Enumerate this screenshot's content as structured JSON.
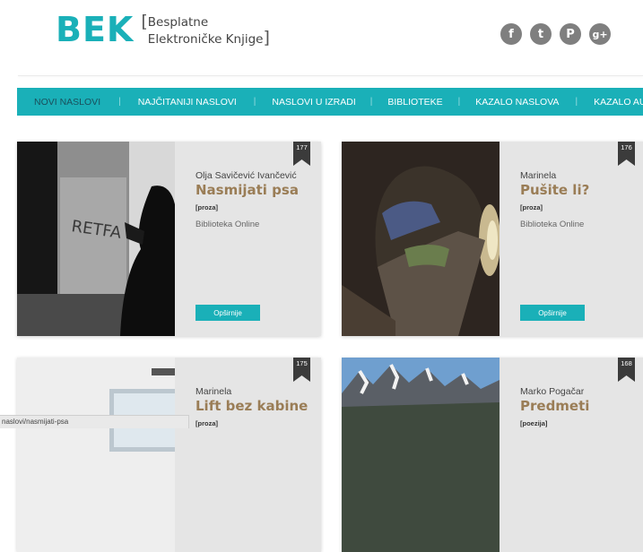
{
  "logo": {
    "brand": "BEK",
    "bracket_open": "[",
    "bracket_close": "]",
    "line1": "Besplatne",
    "line2": "Elektroničke Knjige"
  },
  "social": [
    {
      "name": "facebook-icon",
      "glyph": "f"
    },
    {
      "name": "twitter-icon",
      "glyph": "t"
    },
    {
      "name": "pinterest-icon",
      "glyph": "P"
    },
    {
      "name": "google-plus-icon",
      "glyph": "g+"
    }
  ],
  "nav": {
    "items": [
      "NOVI NASLOVI",
      "NAJČITANIJI NASLOVI",
      "NASLOVI U IZRADI",
      "BIBLIOTEKE",
      "KAZALO NASLOVA",
      "KAZALO AUTORA"
    ],
    "separator": "|"
  },
  "cards": [
    {
      "badge": "177",
      "author": "Olja Savičević Ivančević",
      "title": "Nasmijati psa",
      "genre": "[proza]",
      "library": "Biblioteka Online",
      "button": "Opširnije"
    },
    {
      "badge": "176",
      "author": "Marinela",
      "title": "Pušite li?",
      "genre": "[proza]",
      "library": "Biblioteka Online",
      "button": "Opširnije"
    },
    {
      "badge": "175",
      "author": "Marinela",
      "title": "Lift bez kabine",
      "genre": "[proza]"
    },
    {
      "badge": "168",
      "author": "Marko Pogačar",
      "title": "Predmeti",
      "genre": "[poezija]"
    }
  ],
  "status": {
    "url": "naslovi/nasmijati-psa"
  },
  "colors": {
    "accent": "#1ab0b8",
    "title": "#9a7d56",
    "card_bg": "#e5e5e5"
  }
}
